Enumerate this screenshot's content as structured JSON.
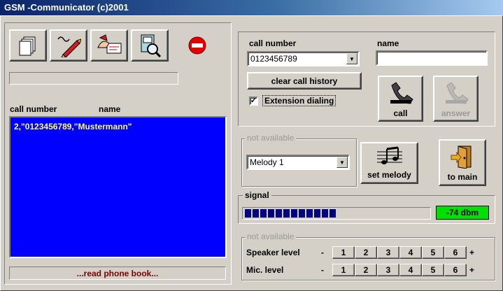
{
  "window": {
    "title": "GSM -Communicator (c)2001"
  },
  "toolbar": {
    "icons": [
      "notepad-icon",
      "pen-write-icon",
      "hand-card-icon",
      "phone-search-icon",
      "stop-icon"
    ]
  },
  "phonebook": {
    "col_number": "call number",
    "col_name": "name",
    "entry": "2,\"0123456789,\"Mustermann\"",
    "status": "...read phone book..."
  },
  "call": {
    "number_label": "call number",
    "name_label": "name",
    "number_value": "0123456789",
    "name_value": "",
    "clear_label": "clear call history",
    "extension_label": "Extension dialing",
    "extension_checked": true,
    "call_label": "call",
    "answer_label": "answer"
  },
  "melody": {
    "group_label": "not available",
    "selected": "Melody 1",
    "set_label": "set melody",
    "to_main_label": "to main"
  },
  "signal": {
    "group_label": "signal",
    "level": 0.5,
    "value": "-74 dbm"
  },
  "levels": {
    "group_label": "not available",
    "speaker_label": "Speaker level",
    "mic_label": "Mic. level",
    "minus": "-",
    "plus": "+",
    "steps": [
      "1",
      "2",
      "3",
      "4",
      "5",
      "6"
    ]
  },
  "colors": {
    "list_bg": "#0000ff",
    "list_text": "#ffff66",
    "signal_bg": "#00e000",
    "status_text": "#800000"
  }
}
